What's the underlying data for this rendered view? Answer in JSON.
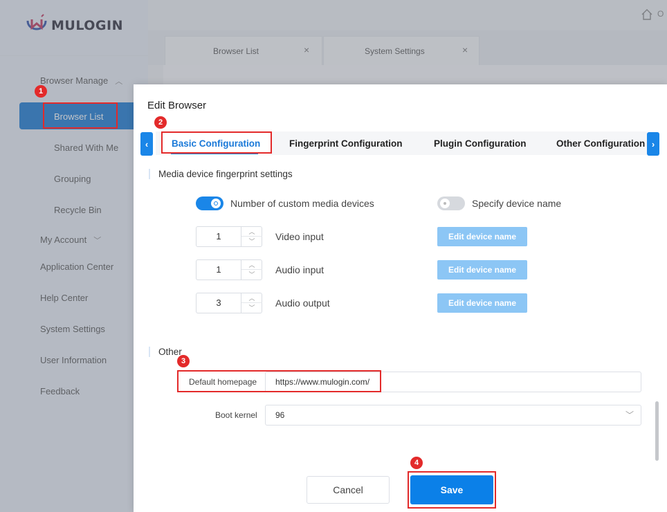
{
  "app": {
    "logo_text": "MULOGIN",
    "top_right_partial": "O"
  },
  "sidebar": {
    "browser_manage": "Browser Manage",
    "browser_list": "Browser List",
    "shared_with_me": "Shared With Me",
    "grouping": "Grouping",
    "recycle_bin": "Recycle Bin",
    "my_account": "My Account",
    "application_center": "Application Center",
    "help_center": "Help Center",
    "system_settings": "System Settings",
    "user_information": "User Information",
    "feedback": "Feedback"
  },
  "page_tabs": [
    {
      "label": "Browser List",
      "close": "×"
    },
    {
      "label": "System Settings",
      "close": "×"
    }
  ],
  "modal": {
    "title": "Edit Browser",
    "prev_arrow": "‹",
    "next_arrow": "›",
    "tabs": [
      {
        "label": "Basic Configuration",
        "active": true
      },
      {
        "label": "Fingerprint Configuration",
        "active": false
      },
      {
        "label": "Plugin Configuration",
        "active": false
      },
      {
        "label": "Other Configuration",
        "active": false
      }
    ],
    "media": {
      "section_title": "Media device fingerprint settings",
      "custom_devices_label": "Number of custom media devices",
      "custom_devices_on": true,
      "specify_name_label": "Specify device name",
      "specify_name_on": false,
      "rows": [
        {
          "value": "1",
          "label": "Video input",
          "button": "Edit device name"
        },
        {
          "value": "1",
          "label": "Audio input",
          "button": "Edit device name"
        },
        {
          "value": "3",
          "label": "Audio output",
          "button": "Edit device name"
        }
      ]
    },
    "other": {
      "section_title": "Other",
      "homepage_label": "Default homepage",
      "homepage_value": "https://www.mulogin.com/",
      "kernel_label": "Boot kernel",
      "kernel_value": "96"
    },
    "cancel": "Cancel",
    "save": "Save"
  },
  "annotations": [
    "1",
    "2",
    "3",
    "4"
  ],
  "colors": {
    "primary": "#1a86e8",
    "highlight": "#e32a2a",
    "disabled_button": "#8cc6f5"
  }
}
